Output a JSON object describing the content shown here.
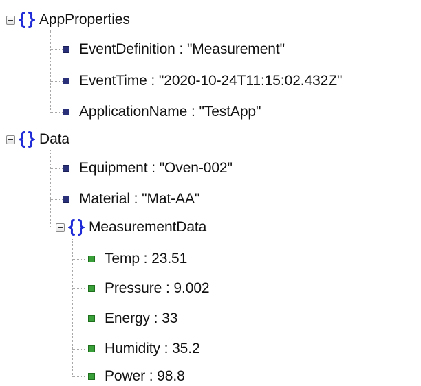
{
  "tree": {
    "app_properties": {
      "label": "AppProperties",
      "children": [
        "EventDefinition : \"Measurement\"",
        "EventTime : \"2020-10-24T11:15:02.432Z\"",
        "ApplicationName : \"TestApp\""
      ]
    },
    "data": {
      "label": "Data",
      "children": [
        "Equipment : \"Oven-002\"",
        "Material : \"Mat-AA\""
      ],
      "measurement_data": {
        "label": "MeasurementData",
        "children": [
          "Temp : 23.51",
          "Pressure : 9.002",
          "Energy : 33",
          "Humidity : 35.2",
          "Power : 98.8"
        ]
      }
    }
  },
  "colors": {
    "object_brace": "#1f2bd6",
    "string_leaf": "#2b3178",
    "number_leaf": "#39a039",
    "guide_line": "#a8a8a8"
  },
  "icons": {
    "object": "braces-icon",
    "collapse": "collapse-toggle-icon",
    "string_leaf": "string-square-icon",
    "number_leaf": "number-square-icon"
  }
}
